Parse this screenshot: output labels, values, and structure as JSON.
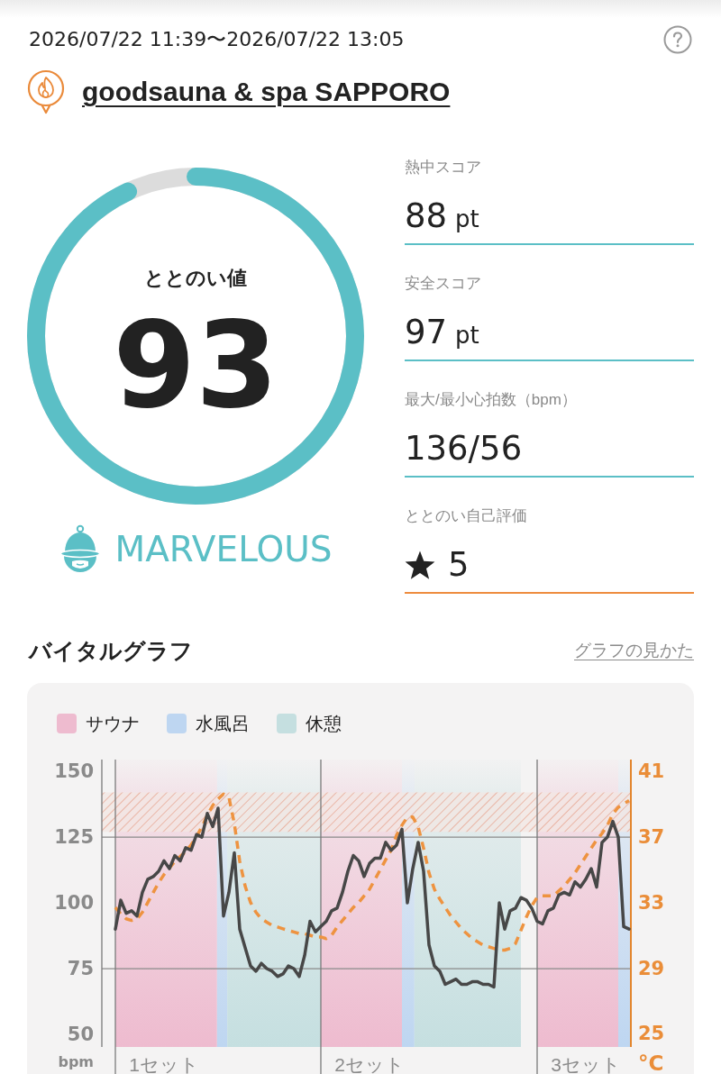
{
  "header": {
    "period": "2026/07/22 11:39〜2026/07/22 13:05",
    "venue": "goodsauna & spa SAPPORO"
  },
  "gauge": {
    "label": "ととのい値",
    "value": "93",
    "level": 0.93
  },
  "rank": {
    "label": "MARVELOUS"
  },
  "stats": [
    {
      "kind": "value",
      "label": "熱中スコア",
      "value": "88",
      "unit": "pt"
    },
    {
      "kind": "value",
      "label": "安全スコア",
      "value": "97",
      "unit": "pt"
    },
    {
      "kind": "value",
      "label": "最大/最小心拍数（bpm）",
      "value": "136/56"
    },
    {
      "kind": "rating",
      "label": "ととのい自己評価",
      "value": "5"
    }
  ],
  "vital": {
    "title": "バイタルグラフ",
    "guide_link": "グラフの見かた",
    "legend": [
      {
        "label": "サウナ",
        "color": "#eebbcf"
      },
      {
        "label": "水風呂",
        "color": "#bed6f1"
      },
      {
        "label": "休憩",
        "color": "#c5dfe0"
      }
    ],
    "chart_data": {
      "type": "line",
      "ylabel": "bpm",
      "y2label": "°C",
      "ylim": [
        45.2,
        154.5
      ],
      "yticks": [
        50,
        75,
        100,
        125,
        150
      ],
      "y2lim": [
        24.2,
        41.7
      ],
      "y2ticks": [
        25,
        29,
        33,
        37,
        41
      ],
      "categories": [
        null,
        null,
        null,
        null,
        null,
        null,
        null,
        null,
        null,
        "1セット",
        null,
        null,
        null,
        null,
        null,
        null,
        null,
        null,
        null,
        null,
        null,
        null,
        null,
        null,
        null,
        null,
        null,
        null,
        null,
        null,
        null,
        null,
        null,
        null,
        null,
        null,
        null,
        null,
        null,
        null,
        null,
        null,
        null,
        null,
        null,
        null,
        null,
        "2セット",
        null,
        null,
        null,
        null,
        null,
        null,
        null,
        null,
        null,
        null,
        null,
        null,
        null,
        null,
        null,
        null,
        null,
        null,
        null,
        null,
        null,
        null,
        null,
        null,
        null,
        null,
        null,
        null,
        null,
        null,
        null,
        null,
        null,
        null,
        null,
        null,
        null,
        null,
        null,
        "3セット",
        null,
        null,
        null,
        null,
        null,
        null,
        null,
        null
      ],
      "series": [
        {
          "color": "#ee9340",
          "axis": "y2",
          "line_style": "dashed",
          "values": [
            32.7,
            32.3,
            32.0,
            31.9,
            32.0,
            32.4,
            33.0,
            33.6,
            34.2,
            34.7,
            35.1,
            35.5,
            35.8,
            36.1,
            36.5,
            37.0,
            37.6,
            38.3,
            38.9,
            39.3,
            39.6,
            39.4,
            37.8,
            35.5,
            34.0,
            33.0,
            32.4,
            32.0,
            31.8,
            31.6,
            31.5,
            31.4,
            31.3,
            31.2,
            31.1,
            31.1,
            31.0,
            30.9,
            30.9,
            30.8,
            31.0,
            31.5,
            31.9,
            32.3,
            32.7,
            33.0,
            33.4,
            33.8,
            34.4,
            35.0,
            35.6,
            36.2,
            37.1,
            37.7,
            38.2,
            38.2,
            37.6,
            36.3,
            34.8,
            33.8,
            33.2,
            32.7,
            32.2,
            31.8,
            31.4,
            31.1,
            30.8,
            30.6,
            30.4,
            30.3,
            30.2,
            30.1,
            30.1,
            30.2,
            30.5,
            31.3,
            32.1,
            32.8,
            33.3,
            33.4,
            33.4,
            33.4,
            33.7,
            34.0,
            34.4,
            34.8,
            35.3,
            35.8,
            36.3,
            36.8,
            37.2,
            37.7,
            38.4,
            38.8,
            39.0,
            39.2
          ]
        },
        {
          "color": "#474747",
          "line_style": "solid",
          "values": [
            90,
            101,
            96,
            97,
            95,
            104,
            109,
            110,
            112,
            116,
            113,
            118,
            116,
            121,
            120,
            126,
            125,
            134,
            129,
            136,
            95,
            104,
            119,
            90,
            83,
            76,
            74,
            77,
            75,
            74,
            72,
            73,
            76,
            75,
            72,
            80,
            93,
            89,
            91,
            93,
            97,
            98,
            104,
            112,
            118,
            116,
            110,
            115,
            117,
            117,
            123,
            120,
            122,
            128,
            100,
            113,
            123,
            112,
            84,
            76,
            74,
            69,
            70,
            71,
            69,
            69,
            70,
            70,
            69,
            69,
            68,
            100,
            90,
            97,
            98,
            102,
            101,
            98,
            93,
            92,
            97,
            98,
            103,
            104,
            103,
            108,
            106,
            109,
            113,
            106,
            123,
            125,
            131,
            125,
            91,
            90
          ]
        }
      ],
      "bands": [
        {
          "axis": "y",
          "from": 127,
          "to": 142
        }
      ],
      "ref_lines": [
        {
          "axis": "y",
          "value": 125
        },
        {
          "axis": "y",
          "value": 75
        }
      ]
    }
  }
}
